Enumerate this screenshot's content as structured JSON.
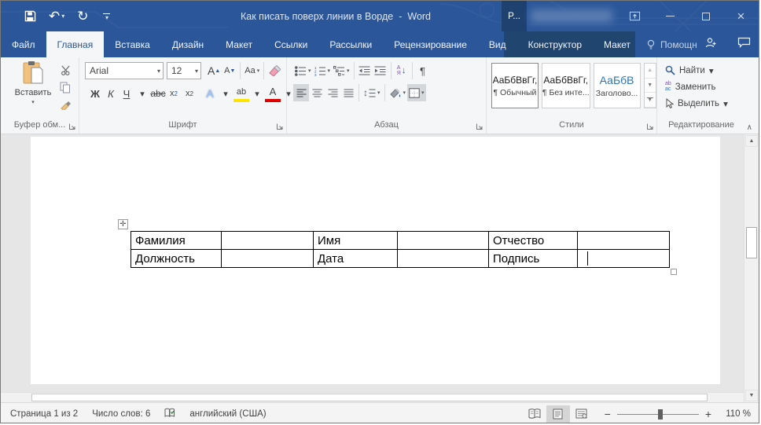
{
  "titlebar": {
    "title_doc": "Как писать поверх линии в Ворде",
    "title_sep": "-",
    "title_app": "Word",
    "user_badge": "P..."
  },
  "icons": {
    "undo": "↶",
    "redo": "↻",
    "caret_down": "▾",
    "close": "×",
    "scroll_up": "▲",
    "scroll_down": "▼",
    "chevron_up": "∧",
    "line_spacing": "↕",
    "sort_a": "А",
    "sort_z": "Я",
    "sort_arrow": "↓",
    "pilcrow": "¶",
    "replace_top": "ab",
    "replace_bottom": "ac",
    "move_handle": "✛"
  },
  "ribbon_tabs": [
    {
      "label": "Файл"
    },
    {
      "label": "Главная"
    },
    {
      "label": "Вставка"
    },
    {
      "label": "Дизайн"
    },
    {
      "label": "Макет"
    },
    {
      "label": "Ссылки"
    },
    {
      "label": "Рассылки"
    },
    {
      "label": "Рецензирование"
    },
    {
      "label": "Вид"
    },
    {
      "label": "Конструктор"
    },
    {
      "label": "Макет"
    }
  ],
  "help": {
    "label": "Помощн"
  },
  "groups": {
    "clipboard": {
      "label": "Буфер обм...",
      "paste": "Вставить"
    },
    "font": {
      "label": "Шрифт",
      "font_name": "Arial",
      "font_size": "12",
      "grow": "А",
      "shrink": "А",
      "change_case": "Aa",
      "bold": "Ж",
      "italic": "К",
      "underline": "Ч",
      "strike": "abc",
      "sub_x": "x",
      "sub_2": "2",
      "sup_x": "x",
      "sup_2": "2",
      "effects": "А",
      "highlight": "ab",
      "color": "А"
    },
    "paragraph": {
      "label": "Абзац"
    },
    "styles": {
      "label": "Стили",
      "items": [
        {
          "preview": "АаБбВвГг,",
          "name": "¶ Обычный"
        },
        {
          "preview": "АаБбВвГг,",
          "name": "¶ Без инте..."
        },
        {
          "preview": "АаБбВ",
          "name": "Заголово..."
        }
      ]
    },
    "editing": {
      "label": "Редактирование",
      "find": "Найти",
      "replace": "Заменить",
      "select": "Выделить"
    }
  },
  "document": {
    "table": {
      "rows": [
        {
          "cells": [
            "Фамилия",
            "",
            "Имя",
            "",
            "Отчество",
            ""
          ]
        },
        {
          "cells": [
            "Должность",
            "",
            "Дата",
            "",
            "Подпись",
            ""
          ]
        }
      ]
    }
  },
  "statusbar": {
    "page": "Страница 1 из 2",
    "words": "Число слов: 6",
    "language": "английский (США)",
    "zoom_out": "−",
    "zoom_in": "+",
    "zoom_level": "110 %"
  }
}
